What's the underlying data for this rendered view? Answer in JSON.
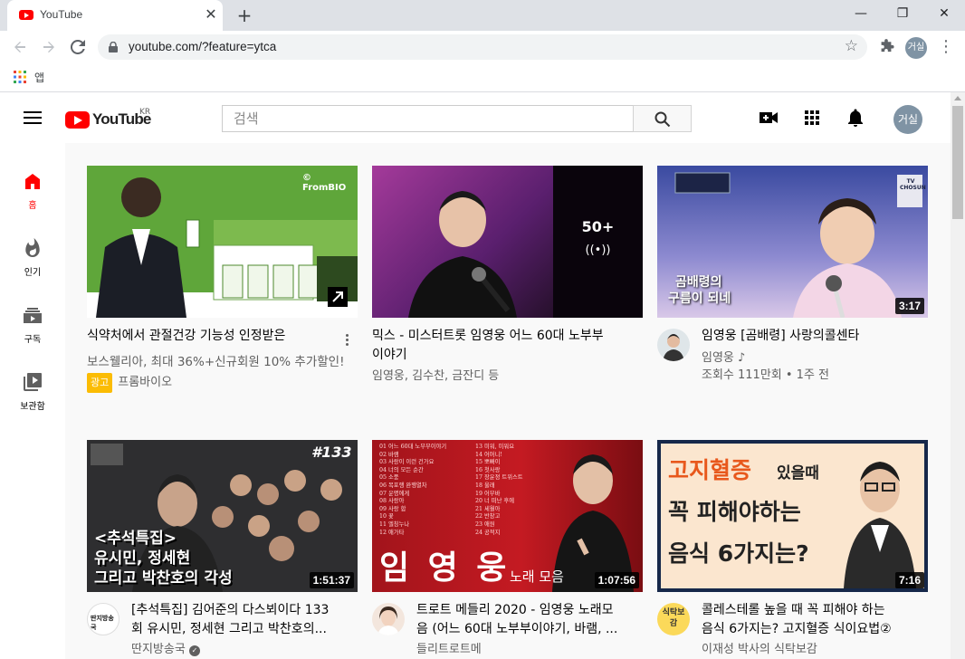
{
  "browser": {
    "tab_title": "YouTube",
    "tab_close": "✕",
    "new_tab": "+",
    "url": "youtube.com/?feature=ytca",
    "profile_initials": "거실",
    "bookmarks_apps_label": "앱",
    "window_controls": {
      "minimize": "—",
      "maximize": "❐",
      "close": "✕"
    }
  },
  "header": {
    "logo_text": "YouTube",
    "region": "KR",
    "search_placeholder": "검색",
    "avatar_initials": "거실"
  },
  "sidebar": {
    "items": [
      {
        "label": "홈",
        "icon": "home-icon",
        "active": true
      },
      {
        "label": "인기",
        "icon": "fire-icon",
        "active": false
      },
      {
        "label": "구독",
        "icon": "subscriptions-icon",
        "active": false
      },
      {
        "label": "보관함",
        "icon": "library-icon",
        "active": false
      }
    ]
  },
  "videos": [
    {
      "title_line1": "식약처에서 관절건강 기능성 인정받은",
      "desc": "보스웰리아, 최대 36%+신규회원 10% 추가할인!",
      "ad_badge": "광고",
      "channel": "프롬바이오",
      "thumb_brand": "© FromBIO"
    },
    {
      "title_line1": "믹스 - 미스터트롯 임영웅 어느 60대 노부부",
      "title_line2": "이야기",
      "meta": "임영웅, 김수찬, 금잔디 등",
      "mix_count": "50+",
      "mix_icon": "((•))"
    },
    {
      "title_line1": "임영웅 [곰배령] 사랑의콜센타",
      "channel": "임영웅 ♪",
      "meta": "조회수 111만회 • 1주 전",
      "duration": "3:17",
      "thumb_caption1": "곰배령의",
      "thumb_caption2": "구름이 되네",
      "thumb_network": "TV CHOSUN"
    },
    {
      "title_line1": "[추석특집] 김어준의 다스뵈이다 133",
      "title_line2": "회 유시민, 정세현 그리고 박찬호의...",
      "channel": "딴지방송국",
      "duration": "1:51:37",
      "thumb_number": "#133",
      "thumb_text1": "<추석특집>",
      "thumb_text2": "유시민, 정세현",
      "thumb_text3": "그리고 박찬호의 각성"
    },
    {
      "title_line1": "트로트 메들리 2020 - 임영웅 노래모",
      "title_line2": "음 (어느 60대 노부부이야기, 바램, ...",
      "channel": "들리트로트메",
      "duration": "1:07:56",
      "thumb_name": "임 영 웅",
      "thumb_sub": "노래 모음",
      "tracklist_left": [
        "01 어느 60대 노부부이야기",
        "02 바램",
        "03 사랑이 이런 건가요",
        "04 너의 모든 순간",
        "05 소풍",
        "06 목포행 완행열차",
        "07 운명에게",
        "08 사랑아",
        "09 사랑 합",
        "10 꽃",
        "11 엘칭누나",
        "12 애가타"
      ],
      "tracklist_right": [
        "13 미워, 미워요",
        "14 어머니!",
        "15 뽀빠이",
        "16 첫사랑",
        "17 장윤정 트위스트",
        "18 울래",
        "19 어부바",
        "20 너 떠난 후에",
        "21 세월아",
        "22 반창고",
        "23 애원",
        "24 공적지"
      ]
    },
    {
      "title_line1": "콜레스테롤 높을 때 꼭 피해야 하는",
      "title_line2": "음식 6가지는? 고지혈증 식이요법②",
      "channel": "이재성 박사의 식탁보감",
      "duration": "7:16",
      "thumb_l1a": "고지혈증",
      "thumb_l1b": "있을때",
      "thumb_l2": "꼭 피해야하는",
      "thumb_l3": "음식 6가지는?",
      "avatar_text": "식탁보감"
    }
  ]
}
